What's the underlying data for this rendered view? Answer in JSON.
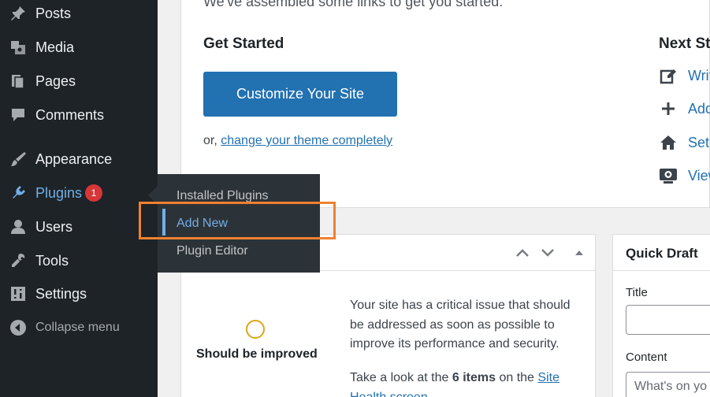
{
  "sidebar": {
    "items": [
      {
        "label": "Posts",
        "icon": "pin-icon"
      },
      {
        "label": "Media",
        "icon": "media-icon"
      },
      {
        "label": "Pages",
        "icon": "pages-icon"
      },
      {
        "label": "Comments",
        "icon": "comment-icon"
      },
      {
        "label": "Appearance",
        "icon": "brush-icon"
      },
      {
        "label": "Plugins",
        "icon": "plugin-icon",
        "badge": "1"
      },
      {
        "label": "Users",
        "icon": "user-icon"
      },
      {
        "label": "Tools",
        "icon": "wrench-icon"
      },
      {
        "label": "Settings",
        "icon": "settings-icon"
      }
    ],
    "collapse_label": "Collapse menu"
  },
  "flyout": {
    "items": [
      "Installed Plugins",
      "Add New",
      "Plugin Editor"
    ]
  },
  "welcome": {
    "intro": "We've assembled some links to get you started:",
    "get_started": "Get Started",
    "customize_button": "Customize Your Site",
    "or_prefix": "or,",
    "change_theme_link": "change your theme completely",
    "next_steps": "Next St",
    "next_items": [
      "Writ",
      "Add",
      "Set",
      "View"
    ]
  },
  "health": {
    "status": "Should be improved",
    "text": "Your site has a critical issue that should be addressed as soon as possible to improve its performance and security.",
    "take_look_prefix": "Take a look at the",
    "items_count": "6 items",
    "on_the": "on the",
    "link": "Site Health screen"
  },
  "draft": {
    "title": "Quick Draft",
    "title_label": "Title",
    "content_label": "Content",
    "content_placeholder": "What's on yo"
  },
  "colors": {
    "sidebar_bg": "#1d2327",
    "accent": "#2271b1",
    "active": "#72aee6",
    "badge": "#d63638",
    "highlight": "#f0812f"
  }
}
